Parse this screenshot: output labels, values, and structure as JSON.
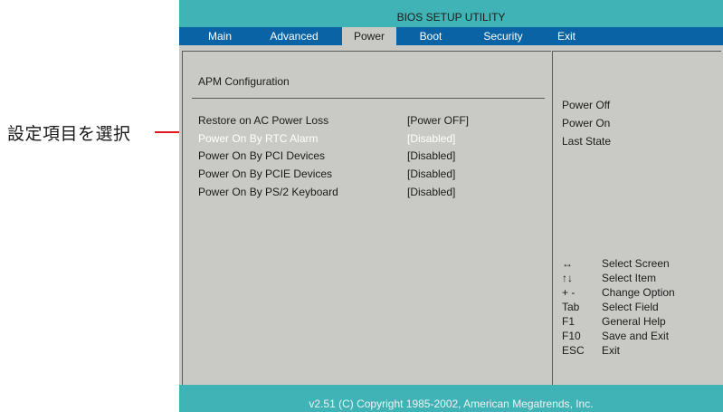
{
  "annotation": {
    "label": "設定項目を選択"
  },
  "bios": {
    "title": "BIOS SETUP UTILITY",
    "menu": [
      "Main",
      "Advanced",
      "Power",
      "Boot",
      "Security",
      "Exit"
    ],
    "active_menu": "Power",
    "section_title": "APM Configuration",
    "options": [
      {
        "label": "Restore on AC Power Loss",
        "value": "[Power OFF]"
      },
      {
        "label": "Power On By RTC Alarm",
        "value": "[Disabled]",
        "selected": true
      },
      {
        "label": "Power On By PCI Devices",
        "value": "[Disabled]"
      },
      {
        "label": "Power On By PCIE Devices",
        "value": "[Disabled]"
      },
      {
        "label": "Power On By PS/2 Keyboard",
        "value": "[Disabled]"
      }
    ],
    "help_options": [
      "Power Off",
      "Power On",
      "Last State"
    ],
    "keys": [
      {
        "key": "↔",
        "desc": "Select Screen"
      },
      {
        "key": "↑↓",
        "desc": "Select Item"
      },
      {
        "key": "+ -",
        "desc": "Change Option"
      },
      {
        "key": "Tab",
        "desc": "Select Field"
      },
      {
        "key": "F1",
        "desc": "General Help"
      },
      {
        "key": "F10",
        "desc": "Save and Exit"
      },
      {
        "key": "ESC",
        "desc": "Exit"
      }
    ],
    "footer": "v2.51 (C) Copyright 1985-2002, American Megatrends, Inc."
  },
  "colors": {
    "title_bar": "#3fb3b5",
    "menu_bar": "#0a63a5",
    "body_bg": "#c9c9c5",
    "annotation_line": "#e4181c"
  }
}
